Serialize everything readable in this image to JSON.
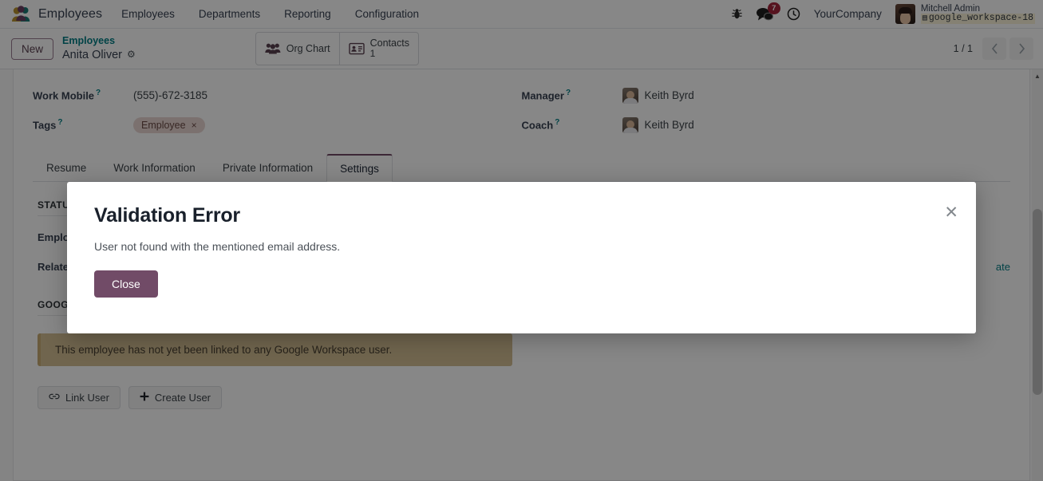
{
  "navbar": {
    "brand": "Employees",
    "brand_icon": "employees-people-icon",
    "menu": [
      {
        "label": "Employees"
      },
      {
        "label": "Departments"
      },
      {
        "label": "Reporting"
      },
      {
        "label": "Configuration"
      }
    ],
    "bug_icon": "bug-icon",
    "messages_icon": "chat-bubbles-icon",
    "messages_count": "7",
    "activity_icon": "clock-icon",
    "company": "YourCompany",
    "user_name": "Mitchell Admin",
    "user_db": "google_workspace-18",
    "db_icon": "database-icon",
    "avatar": "user-avatar"
  },
  "control_panel": {
    "new_label": "New",
    "breadcrumb_parent": "Employees",
    "breadcrumb_current": "Anita Oliver",
    "gear_icon": "gear-icon",
    "stat_buttons": [
      {
        "label": "Org Chart",
        "sub": "",
        "icon": "org-chart-people-icon"
      },
      {
        "label": "Contacts",
        "sub": "1",
        "icon": "contact-card-icon"
      }
    ],
    "pager_text": "1 / 1",
    "prev_icon": "chevron-left-icon",
    "next_icon": "chevron-right-icon"
  },
  "form": {
    "left_fields": [
      {
        "label": "Work Mobile",
        "value": "(555)-672-3185",
        "help": "?"
      },
      {
        "label": "Tags",
        "value": "Employee",
        "help": "?",
        "tag_remove": "×"
      }
    ],
    "right_fields": [
      {
        "label": "Manager",
        "value": "Keith Byrd",
        "help": "?"
      },
      {
        "label": "Coach",
        "value": "Keith Byrd",
        "help": "?"
      }
    ]
  },
  "tabs": [
    {
      "label": "Resume",
      "active": false
    },
    {
      "label": "Work Information",
      "active": false
    },
    {
      "label": "Private Information",
      "active": false
    },
    {
      "label": "Settings",
      "active": true
    }
  ],
  "settings_tab": {
    "status_section_title": "STATUS",
    "rows": [
      {
        "label": "Employee Type"
      },
      {
        "label": "Related User"
      }
    ],
    "right_link_partial": "ate",
    "google_section_title": "GOOGLE WORKSPACE",
    "alert_text": "This employee has not yet been linked to any Google Workspace user.",
    "buttons": [
      {
        "label": "Link User",
        "icon": "link-chain-icon"
      },
      {
        "label": "Create User",
        "icon": "plus-icon"
      }
    ]
  },
  "modal": {
    "title": "Validation Error",
    "message": "User not found with the mentioned email address.",
    "close_button": "Close",
    "close_icon": "close-x-icon"
  },
  "colors": {
    "accent": "#714b67",
    "link": "#017e84",
    "badge": "#a3243b",
    "alert_bg": "#d3bf94",
    "tag_bg": "#e8d6d1"
  }
}
